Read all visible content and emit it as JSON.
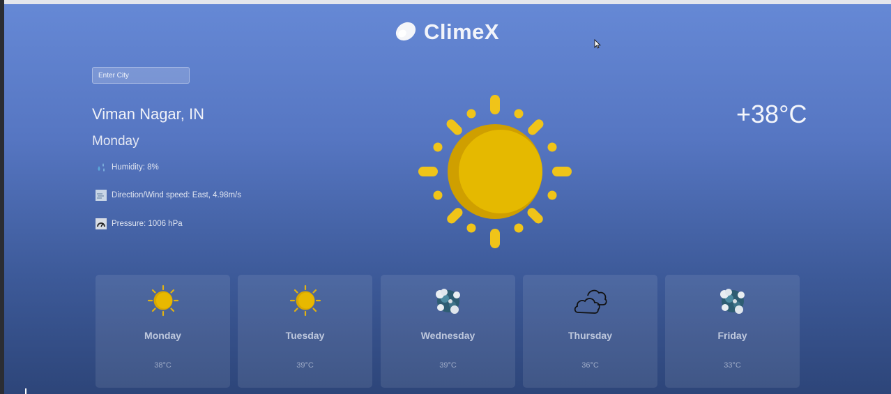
{
  "app": {
    "title": "ClimeX",
    "logo_icon": "cloud-icon"
  },
  "search": {
    "placeholder": "Enter City"
  },
  "current": {
    "location": "Viman Nagar, IN",
    "day": "Monday",
    "temperature": "+38°C",
    "condition_icon": "sun-icon",
    "details": [
      {
        "icon": "humidity-icon",
        "text": "Humidity: 8%"
      },
      {
        "icon": "wind-icon",
        "text": "Direction/Wind speed: East, 4.98m/s"
      },
      {
        "icon": "pressure-icon",
        "text": "Pressure: 1006 hPa"
      }
    ]
  },
  "forecast": [
    {
      "day": "Monday",
      "temp": "38°C",
      "icon": "sun-icon"
    },
    {
      "day": "Tuesday",
      "temp": "39°C",
      "icon": "sun-icon"
    },
    {
      "day": "Wednesday",
      "temp": "39°C",
      "icon": "cloudy-globe-icon"
    },
    {
      "day": "Thursday",
      "temp": "36°C",
      "icon": "cloud-outline-icon"
    },
    {
      "day": "Friday",
      "temp": "33°C",
      "icon": "cloudy-globe-icon"
    }
  ],
  "colors": {
    "sun": "#e8b800",
    "sun_ray": "#f0c419",
    "background_top": "#6689d6",
    "background_bottom": "#2d4579"
  }
}
